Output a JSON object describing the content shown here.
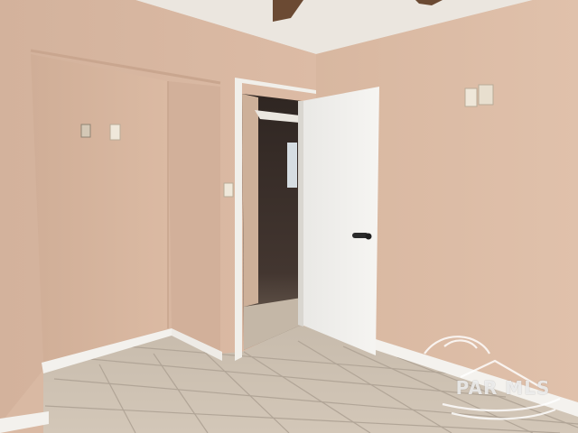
{
  "scene": {
    "kind": "photo",
    "colors": {
      "wall_right": "#dcbda6",
      "wall_left": "#d8b7a1",
      "closet_back": "#d5b49d",
      "ceiling": "#ece7e0",
      "floor_tile": "#cfc3b4",
      "grout": "#b2a699",
      "baseboard": "#f4f2ee",
      "door": "#f2f1ee",
      "hallway": "#3c302a"
    }
  },
  "watermark": {
    "text": "PAR MLS"
  }
}
